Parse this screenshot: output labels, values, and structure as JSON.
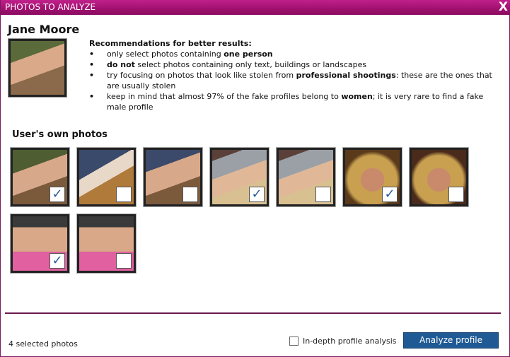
{
  "window": {
    "title": "PHOTOS TO ANALYZE",
    "close": "X"
  },
  "profile": {
    "name": "Jane Moore"
  },
  "recommendations": {
    "heading": "Recommendations for better results:",
    "items": [
      {
        "pre": "only select photos containing ",
        "bold": "one person",
        "post": ""
      },
      {
        "pre": "",
        "bold": "do not",
        "post": " select photos containing only text, buildings or landscapes"
      },
      {
        "pre": "try focusing on photos that look like stolen from ",
        "bold": "professional shootings",
        "post": ": these are the ones that are usually stolen"
      },
      {
        "pre": "keep in mind that almost 97% of the fake profiles belong to ",
        "bold": "women",
        "post": "; it is very rare to find a fake male profile"
      }
    ]
  },
  "photos_section": {
    "title": "User's own photos"
  },
  "photos": [
    {
      "checked": true,
      "bg": "linear-gradient(160deg,#4f5e32 0 32%,#d8a88a 32% 62%,#7b5a3c 62%)"
    },
    {
      "checked": false,
      "bg": "linear-gradient(150deg,#3a4a6a 0 35%,#e8d8c8 35% 55%,#b07a3a 55%)"
    },
    {
      "checked": false,
      "bg": "linear-gradient(160deg,#3b4a6a 0 30%,#d8a88a 30% 62%,#7b5a3c 62%)"
    },
    {
      "checked": true,
      "bg": "linear-gradient(160deg,#5a4038 0 15%,#9aa0a6 15% 40%,#e0b898 40% 65%,#d8c090 65%)"
    },
    {
      "checked": false,
      "bg": "linear-gradient(160deg,#5a4038 0 15%,#9aa0a6 15% 40%,#e0b898 40% 65%,#d8c090 65%)"
    },
    {
      "checked": true,
      "bg": "radial-gradient(circle at 50% 55%,#c88a6a 0 28%,#c8a050 30% 60%,#5a3a1a 70%)"
    },
    {
      "checked": false,
      "bg": "radial-gradient(circle at 50% 55%,#c88a6a 0 28%,#c8a050 30% 60%,#4a2a1a 70%)"
    },
    {
      "checked": true,
      "bg": "linear-gradient(180deg,#3a3a3a 0 20%,#d8a888 20% 65%,#e060a0 65%)"
    },
    {
      "checked": false,
      "bg": "linear-gradient(180deg,#3a3a3a 0 20%,#d8a888 20% 65%,#e060a0 65%)"
    }
  ],
  "footer": {
    "selected_count": "4 selected photos",
    "in_depth_label": "In-depth profile analysis",
    "in_depth_checked": false,
    "analyze_button": "Analyze profile"
  }
}
